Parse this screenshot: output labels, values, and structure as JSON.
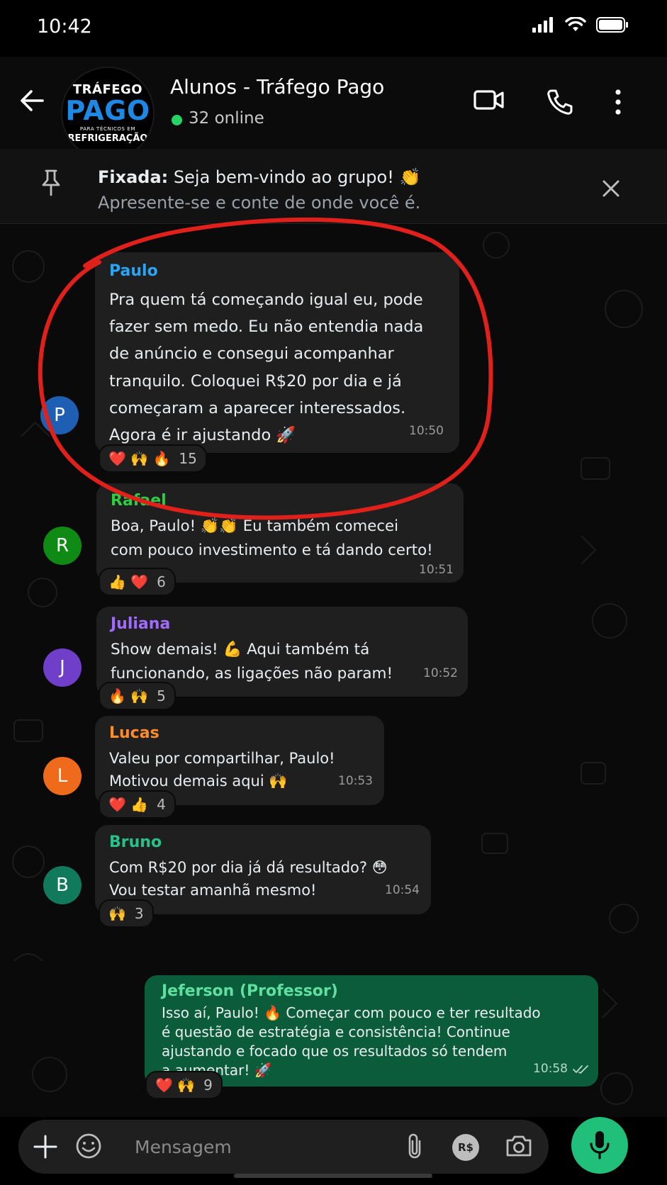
{
  "status_bar": {
    "time": "10:42"
  },
  "header": {
    "group_name": "Alunos - Tráfego Pago",
    "online": "32 online",
    "logo": {
      "line1": "TRÁFEGO",
      "line2": "PAGO",
      "line3": "PARA TÉCNICOS EM",
      "line4": "REFRIGERAÇÃO"
    }
  },
  "pinned": {
    "label": "Fixada:",
    "line1": "Seja bem-vindo ao grupo! 👏",
    "line2": "Apresente-se e conte de onde você é."
  },
  "messages": [
    {
      "initial": "P",
      "sender": "Paulo",
      "text": "Pra quem tá começando igual eu, pode\nfazer sem medo. Eu não entendia nada\nde anúncio e consegui acompanhar\ntranquilo. Coloquei R$20 por dia e já\ncomeçaram a aparecer interessados.\nAgora é ir ajustando 🚀",
      "time": "10:50",
      "reactions": "❤️ 🙌 🔥",
      "reaction_count": "15"
    },
    {
      "initial": "R",
      "sender": "Rafael",
      "text": "Boa, Paulo! 👏👏 Eu também comecei\ncom pouco investimento e tá dando certo!",
      "time": "10:51",
      "reactions": "👍 ❤️",
      "reaction_count": "6"
    },
    {
      "initial": "J",
      "sender": "Juliana",
      "text": "Show demais! 💪 Aqui também tá\nfuncionando, as ligações não param!",
      "time": "10:52",
      "reactions": "🔥 🙌",
      "reaction_count": "5"
    },
    {
      "initial": "L",
      "sender": "Lucas",
      "text": "Valeu por compartilhar, Paulo!\nMotivou demais aqui 🙌",
      "time": "10:53",
      "reactions": "❤️ 👍",
      "reaction_count": "4"
    },
    {
      "initial": "B",
      "sender": "Bruno",
      "text": "Com R$20 por dia já dá resultado? 😳\nVou testar amanhã mesmo!",
      "time": "10:54",
      "reactions": "🙌",
      "reaction_count": "3"
    },
    {
      "sender": "Jeferson (Professor)",
      "text": "Isso aí, Paulo! 🔥 Começar com pouco e ter resultado\né questão de estratégia e consistência! Continue\najustando e focado que os resultados só tendem\na aumentar! 🚀",
      "time": "10:58",
      "reactions": "❤️ 🙌",
      "reaction_count": "9"
    }
  ],
  "input": {
    "placeholder": "Mensagem",
    "currency_badge": "R$"
  },
  "colors": {
    "accent_green": "#21c07a",
    "outgoing_bubble": "#0a5c3a",
    "annotation_red": "#e0201b"
  }
}
